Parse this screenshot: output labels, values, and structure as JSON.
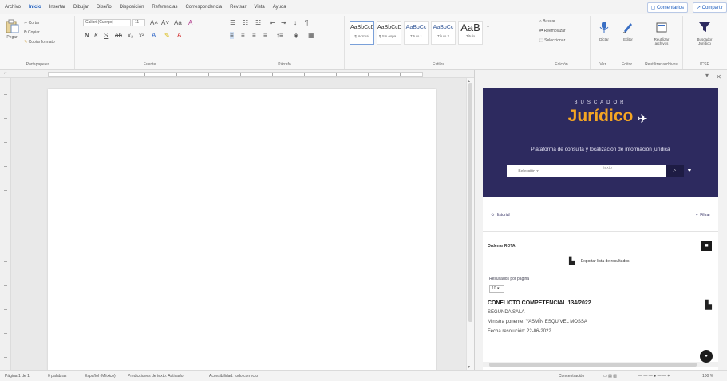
{
  "tabs": {
    "items": [
      "Archivo",
      "Inicio",
      "Insertar",
      "Dibujar",
      "Diseño",
      "Disposición",
      "Referencias",
      "Correspondencia",
      "Revisar",
      "Vista",
      "Ayuda"
    ],
    "right": [
      "Comentarios",
      "Compartir"
    ]
  },
  "ribbon": {
    "clipboard": {
      "paste": "Pegar",
      "cut": "Cortar",
      "copy": "Copiar",
      "format": "Copiar formato",
      "label": "Portapapeles"
    },
    "font": {
      "name": "Calibri (Cuerpo)",
      "size": "11",
      "label": "Fuente"
    },
    "paragraph": {
      "label": "Párrafo"
    },
    "styles": {
      "items": [
        {
          "sample": "AaBbCcDd",
          "name": "¶ Normal"
        },
        {
          "sample": "AaBbCcDd",
          "name": "¶ Sin espa..."
        },
        {
          "sample": "AaBbCc",
          "name": "Título 1"
        },
        {
          "sample": "AaBbCc",
          "name": "Título 2"
        },
        {
          "sample": "AaB",
          "name": "Título"
        }
      ],
      "label": "Estilos"
    },
    "editing": {
      "find": "Buscar",
      "replace": "Reemplazar",
      "select": "Seleccionar",
      "label": "Edición"
    },
    "voice": {
      "dictate": "Dictar",
      "label": "Voz"
    },
    "editor": {
      "label": "Editor",
      "group": "Editor"
    },
    "addins": [
      {
        "label": "Reutilizar archivos",
        "group": "Reutilizar archivos"
      },
      {
        "label": "Buscador Jurídico",
        "group": "ICSE"
      }
    ]
  },
  "pane": {
    "logo_top": "BUSCADOR",
    "logo": "Jurídico",
    "tagline": "Plataforma de consulta y localización de información jurídica",
    "search_scope": "Selección",
    "search_placeholder": "texto",
    "tools_left": "Historial",
    "tools_right": "Filtrar",
    "ordenar": "Ordenar ROTA",
    "export": "Exportar lista de resultados",
    "per_page_label": "Resultados por página",
    "per_page": "10",
    "result": {
      "title": "CONFLICTO COMPETENCIAL 134/2022",
      "lines": [
        "SEGUNDA SALA",
        "Ministra ponente: YASMÍN ESQUIVEL MOSSA",
        "Fecha resolución: 22-06-2022"
      ]
    }
  },
  "status": {
    "items": [
      "Página 1 de 1",
      "0 palabras",
      "Español (México)",
      "Predicciones de texto: Activado",
      "Accesibilidad: todo correcto"
    ],
    "right": [
      "Concentración",
      "100 %"
    ]
  },
  "colors": {
    "banner": "#2d2a5f",
    "logo": "#f5a623",
    "accent": "#185abd"
  }
}
